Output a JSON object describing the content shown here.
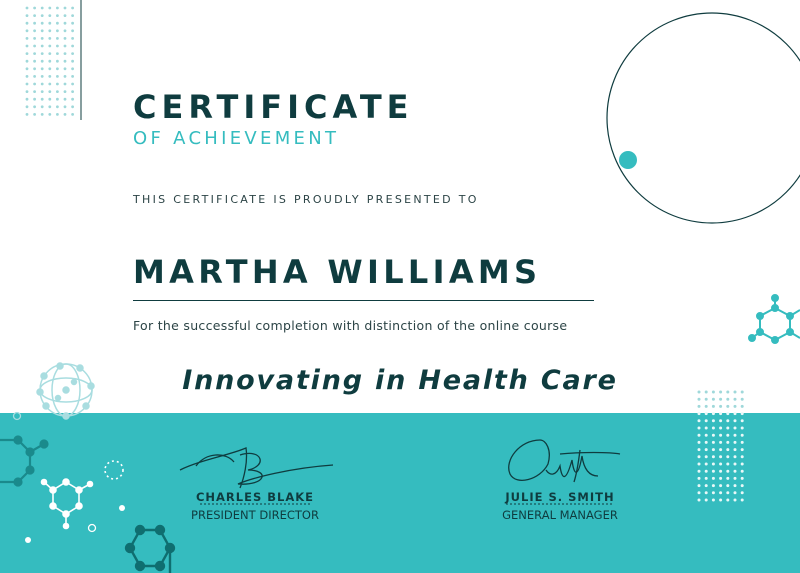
{
  "certificate": {
    "title": "CERTIFICATE",
    "subtitle": "OF ACHIEVEMENT",
    "presented_to": "THIS CERTIFICATE IS PROUDLY PRESENTED TO",
    "recipient": "MARTHA WILLIAMS",
    "description": "For the successful completion with distinction of the online course",
    "course": "Innovating in Health Care"
  },
  "signatories": [
    {
      "name": "CHARLES BLAKE",
      "role": "PRESIDENT DIRECTOR"
    },
    {
      "name": "JULIE S. SMITH",
      "role": "GENERAL MANAGER"
    }
  ],
  "colors": {
    "dark_teal": "#0f3c3f",
    "accent_teal": "#35bcbf",
    "light_dots": "#9fd8da",
    "background": "#ffffff"
  },
  "icons": [
    "molecule-icon",
    "dot-grid",
    "signature"
  ]
}
